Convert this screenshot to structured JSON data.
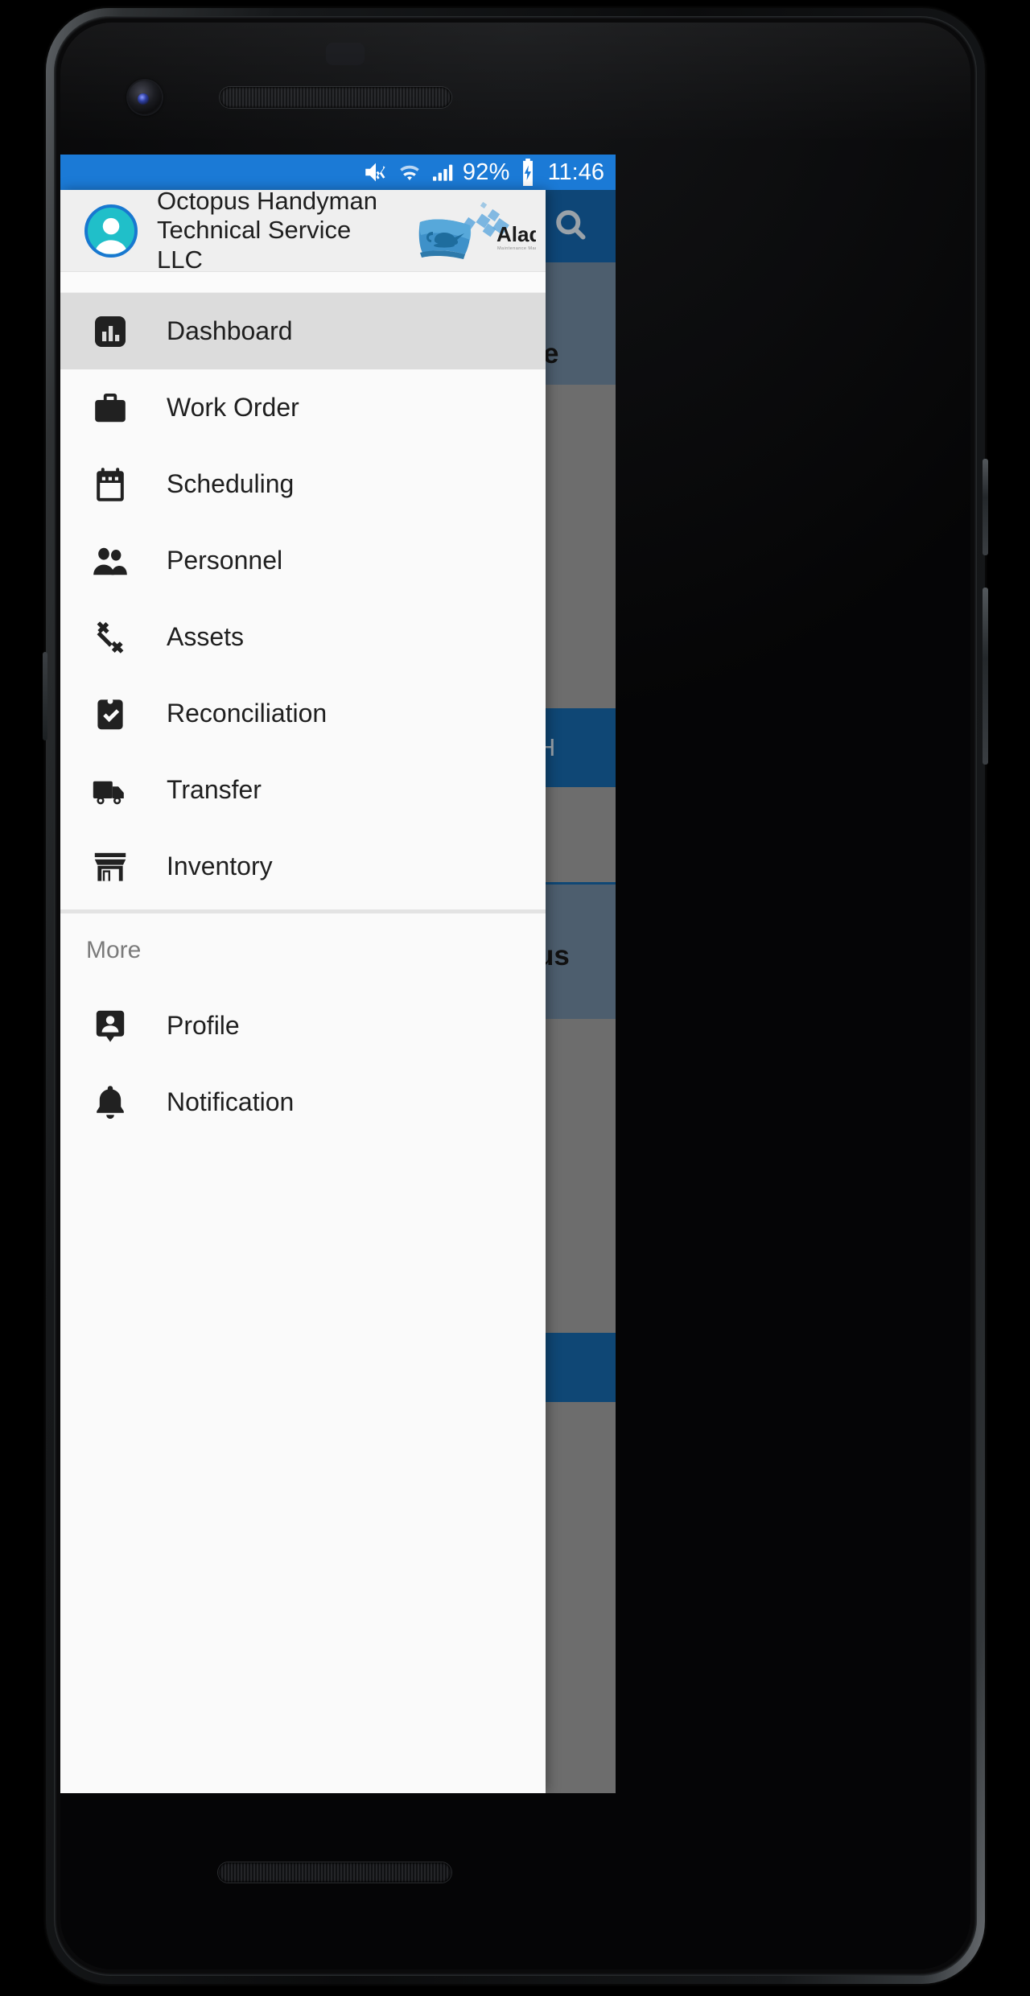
{
  "status_bar": {
    "icons": [
      "volume-mute-icon",
      "wifi-icon",
      "cellular-signal-icon",
      "battery-charging-icon"
    ],
    "battery_percent": "92%",
    "clock": "11:46",
    "background_color": "#1b7ad6"
  },
  "drawer": {
    "header": {
      "avatar_name": "user-avatar",
      "org_name": "Octopus Handyman\nTechnical Service LLC",
      "brand": {
        "name": "Aladdin",
        "tagline": "Maintenance Management Software"
      }
    },
    "items": [
      {
        "label": "Dashboard",
        "icon": "bar-chart-icon",
        "selected": true
      },
      {
        "label": "Work Order",
        "icon": "briefcase-icon",
        "selected": false
      },
      {
        "label": "Scheduling",
        "icon": "calendar-icon",
        "selected": false
      },
      {
        "label": "Personnel",
        "icon": "people-icon",
        "selected": false
      },
      {
        "label": "Assets",
        "icon": "wrench-icon",
        "selected": false
      },
      {
        "label": "Reconciliation",
        "icon": "clipboard-check-icon",
        "selected": false
      },
      {
        "label": "Transfer",
        "icon": "truck-icon",
        "selected": false
      },
      {
        "label": "Inventory",
        "icon": "store-icon",
        "selected": false
      }
    ],
    "more_section_label": "More",
    "more_items": [
      {
        "label": "Profile",
        "icon": "person-pin-icon"
      },
      {
        "label": "Notification",
        "icon": "bell-icon"
      }
    ],
    "colors": {
      "background": "#fafafa",
      "selected_item": "#dcdcdc",
      "header_background": "#efefef"
    }
  },
  "background_app": {
    "appbar_color": "#0e4677",
    "search_icon": "search-icon",
    "visible_text_fragments": [
      {
        "text": "e",
        "note": "partially occluded card title"
      },
      {
        "text": "TH",
        "note": "partially occluded button label"
      },
      {
        "text": "us",
        "note": "partially occluded card title"
      }
    ],
    "scrim_color": "#6d6d6d",
    "card_color": "#4d5e6e",
    "button_color": "#0f4775"
  },
  "device": {
    "front_camera": "front-camera",
    "earpiece": "earpiece-speaker",
    "bottom_speaker": "bottom-speaker"
  }
}
